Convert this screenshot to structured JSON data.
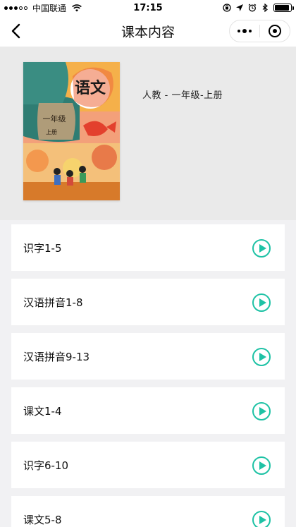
{
  "status_bar": {
    "carrier": "中国联通",
    "time": "17:15"
  },
  "nav": {
    "title": "课本内容"
  },
  "book": {
    "label": "人教 - 一年级-上册",
    "cover_title": "语文",
    "cover_grade": "一年级",
    "cover_volume": "上册"
  },
  "lessons": [
    {
      "title": "识字1-5"
    },
    {
      "title": "汉语拼音1-8"
    },
    {
      "title": "汉语拼音9-13"
    },
    {
      "title": "课文1-4"
    },
    {
      "title": "识字6-10"
    },
    {
      "title": "课文5-8"
    }
  ],
  "colors": {
    "accent": "#1ec2a5",
    "header_bg": "#eaeaea",
    "page_bg": "#f1f1f3"
  }
}
